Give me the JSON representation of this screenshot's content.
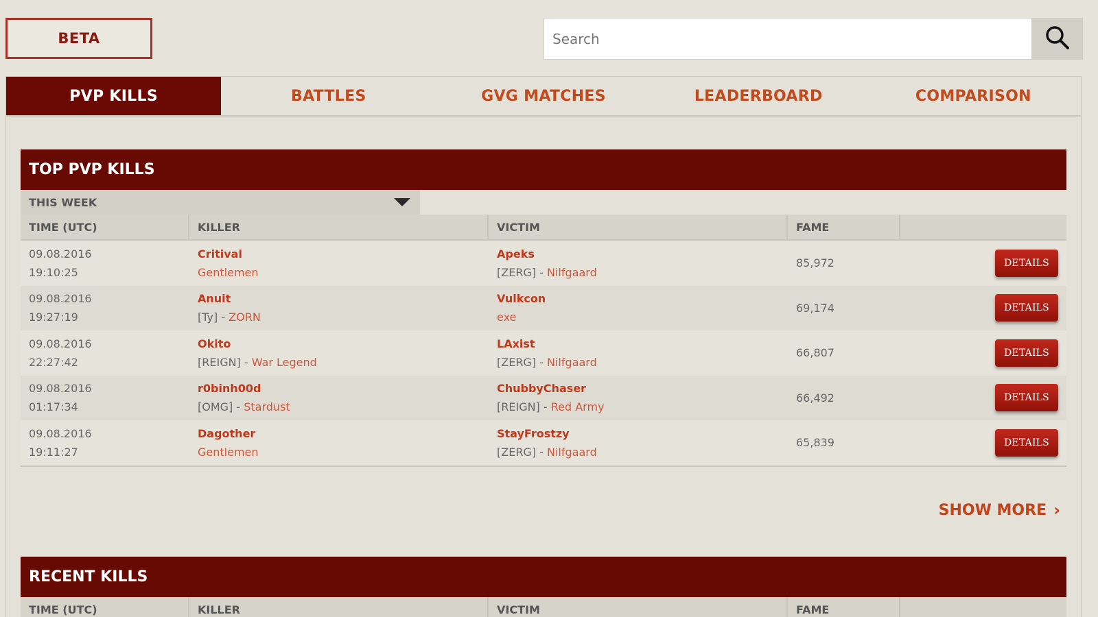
{
  "header": {
    "beta_label": "BETA",
    "search_placeholder": "Search"
  },
  "tabs": [
    {
      "label": "PVP KILLS",
      "active": true
    },
    {
      "label": "BATTLES",
      "active": false
    },
    {
      "label": "GVG MATCHES",
      "active": false
    },
    {
      "label": "LEADERBOARD",
      "active": false
    },
    {
      "label": "COMPARISON",
      "active": false
    }
  ],
  "top_kills": {
    "title": "TOP PVP KILLS",
    "period": "THIS WEEK",
    "columns": [
      "TIME (UTC)",
      "KILLER",
      "VICTIM",
      "FAME"
    ],
    "rows": [
      {
        "date": "09.08.2016",
        "time": "19:10:25",
        "killer": "Critival",
        "killer_alliance": "",
        "killer_guild": "Gentlemen",
        "victim": "Apeks",
        "victim_alliance": "[ZERG] - ",
        "victim_guild": "Nilfgaard",
        "fame": "85,972",
        "button": "DETAILS"
      },
      {
        "date": "09.08.2016",
        "time": "19:27:19",
        "killer": "Anuit",
        "killer_alliance": "[Ty] - ",
        "killer_guild": "ZORN",
        "victim": "Vulkcon",
        "victim_alliance": "",
        "victim_guild": "exe",
        "fame": "69,174",
        "button": "DETAILS"
      },
      {
        "date": "09.08.2016",
        "time": "22:27:42",
        "killer": "Okito",
        "killer_alliance": "[REIGN] - ",
        "killer_guild": "War Legend",
        "victim": "LAxist",
        "victim_alliance": "[ZERG] - ",
        "victim_guild": "Nilfgaard",
        "fame": "66,807",
        "button": "DETAILS"
      },
      {
        "date": "09.08.2016",
        "time": "01:17:34",
        "killer": "r0binh00d",
        "killer_alliance": "[OMG] - ",
        "killer_guild": "Stardust",
        "victim": "ChubbyChaser",
        "victim_alliance": "[REIGN] - ",
        "victim_guild": "Red Army",
        "fame": "66,492",
        "button": "DETAILS"
      },
      {
        "date": "09.08.2016",
        "time": "19:11:27",
        "killer": "Dagother",
        "killer_alliance": "",
        "killer_guild": "Gentlemen",
        "victim": "StayFrostzy",
        "victim_alliance": "[ZERG] - ",
        "victim_guild": "Nilfgaard",
        "fame": "65,839",
        "button": "DETAILS"
      }
    ],
    "show_more": "SHOW MORE"
  },
  "recent_kills": {
    "title": "RECENT KILLS",
    "columns": [
      "TIME (UTC)",
      "KILLER",
      "VICTIM",
      "FAME"
    ]
  },
  "colors": {
    "accent": "#680a04",
    "link": "#c0391b",
    "button": "#b0200f"
  }
}
